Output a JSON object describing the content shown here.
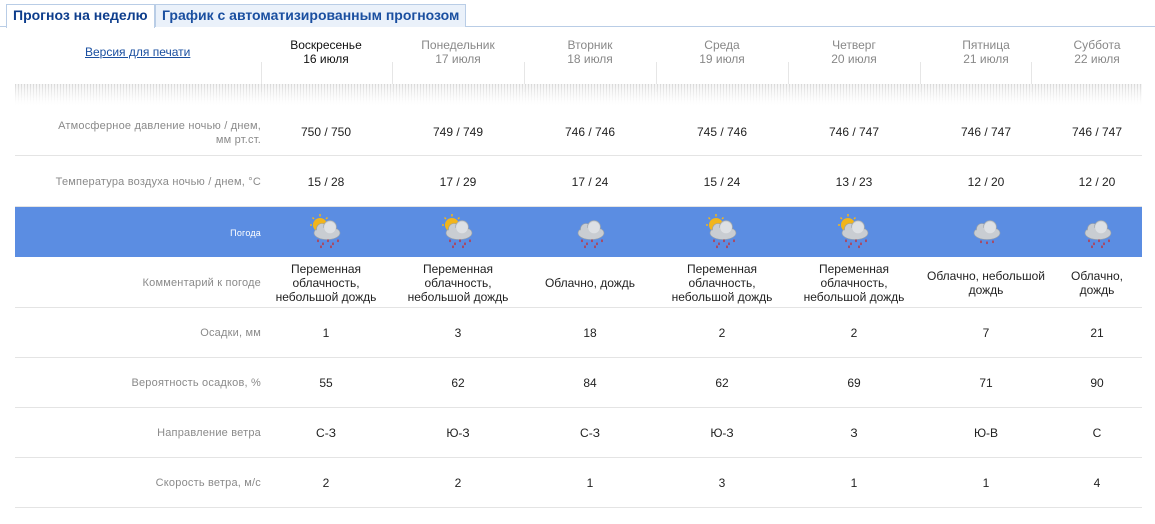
{
  "tabs": [
    {
      "label": "Прогноз на неделю",
      "active": true
    },
    {
      "label": "График с автоматизированным прогнозом",
      "active": false
    }
  ],
  "print_link": "Версия для печати",
  "days": [
    {
      "name": "Воскресенье",
      "date": "16 июля"
    },
    {
      "name": "Понедельник",
      "date": "17 июля"
    },
    {
      "name": "Вторник",
      "date": "18 июля"
    },
    {
      "name": "Среда",
      "date": "19 июля"
    },
    {
      "name": "Четверг",
      "date": "20 июля"
    },
    {
      "name": "Пятница",
      "date": "21 июля"
    },
    {
      "name": "Суббота",
      "date": "22 июля"
    }
  ],
  "rows": {
    "pressure": {
      "label_line1": "Атмосферное давление ночью / днем,",
      "label_line2": "мм рт.ст.",
      "values": [
        "750 / 750",
        "749 / 749",
        "746 / 746",
        "745 / 746",
        "746 / 747",
        "746 / 747",
        "746 / 747"
      ]
    },
    "temperature": {
      "label": "Температура воздуха ночью / днем, °С",
      "values": [
        "15 / 28",
        "17 / 29",
        "17 / 24",
        "15 / 24",
        "13 / 23",
        "12 / 20",
        "12 / 20"
      ]
    },
    "weather": {
      "label": "Погода",
      "icons": [
        "sun-cloud-rain-icon",
        "sun-cloud-rain-icon",
        "cloud-rain-icon",
        "sun-cloud-rain-icon",
        "sun-cloud-rain-icon",
        "cloud-light-rain-icon",
        "cloud-rain-icon"
      ]
    },
    "comment": {
      "label": "Комментарий к погоде",
      "values": [
        [
          "Переменная",
          "облачность,",
          "небольшой дождь"
        ],
        [
          "Переменная",
          "облачность,",
          "небольшой дождь"
        ],
        [
          "Облачно, дождь"
        ],
        [
          "Переменная",
          "облачность,",
          "небольшой дождь"
        ],
        [
          "Переменная",
          "облачность,",
          "небольшой дождь"
        ],
        [
          "Облачно, небольшой",
          "дождь"
        ],
        [
          "Облачно,",
          "дождь"
        ]
      ]
    },
    "precipitation": {
      "label": "Осадки, мм",
      "values": [
        "1",
        "3",
        "18",
        "2",
        "2",
        "7",
        "21"
      ]
    },
    "probability": {
      "label": "Вероятность осадков, %",
      "values": [
        "55",
        "62",
        "84",
        "62",
        "69",
        "71",
        "90"
      ]
    },
    "wind_direction": {
      "label": "Направление ветра",
      "values": [
        "С-З",
        "Ю-З",
        "С-З",
        "Ю-З",
        "З",
        "Ю-В",
        "С"
      ]
    },
    "wind_speed": {
      "label": "Скорость ветра, м/с",
      "values": [
        "2",
        "2",
        "1",
        "3",
        "1",
        "1",
        "4"
      ]
    }
  },
  "colors": {
    "weather_band": "#5b8de2",
    "sun": "#f2b51b",
    "cloud": "#c9cdd2",
    "rain": "#cc2a2a",
    "link": "#1a4fa0"
  }
}
